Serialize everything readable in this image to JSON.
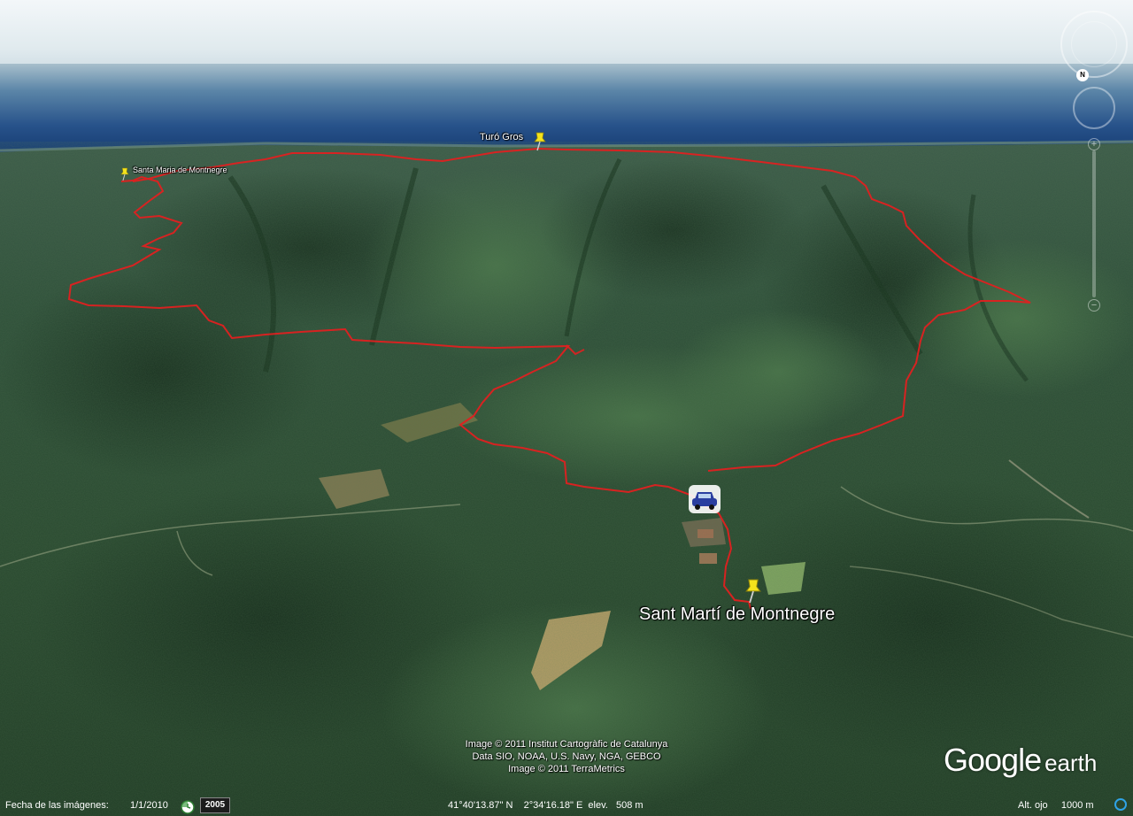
{
  "map": {
    "labels": {
      "turo_gros": "Turó Gros",
      "santa_maria": "Santa Maria de Montnegre",
      "sant_marti": "Sant Martí de Montnegre"
    }
  },
  "navigation": {
    "north_label": "N",
    "zoom_plus": "+",
    "zoom_minus": "−"
  },
  "attribution": {
    "line1": "Image © 2011 Institut Cartogràfic de Catalunya",
    "line2": "Data SIO, NOAA, U.S. Navy, NGA, GEBCO",
    "line3": "Image © 2011 TerraMetrics"
  },
  "logo": {
    "google": "Google",
    "earth": "earth"
  },
  "status_bar": {
    "imagery_date_label": "Fecha de las imágenes:",
    "imagery_date_value": "1/1/2010",
    "historical_year": "2005",
    "coordinates": "41°40'13.87\" N    2°34'16.18\" E  elev.   508 m",
    "eye_altitude": "Alt. ojo     1000 m"
  },
  "colors": {
    "route": "#e02020",
    "forest": "#2e4f2e",
    "sea": "#1d4f8a",
    "sky": "#dfe9ee",
    "pushpin": "#f4e31c"
  }
}
